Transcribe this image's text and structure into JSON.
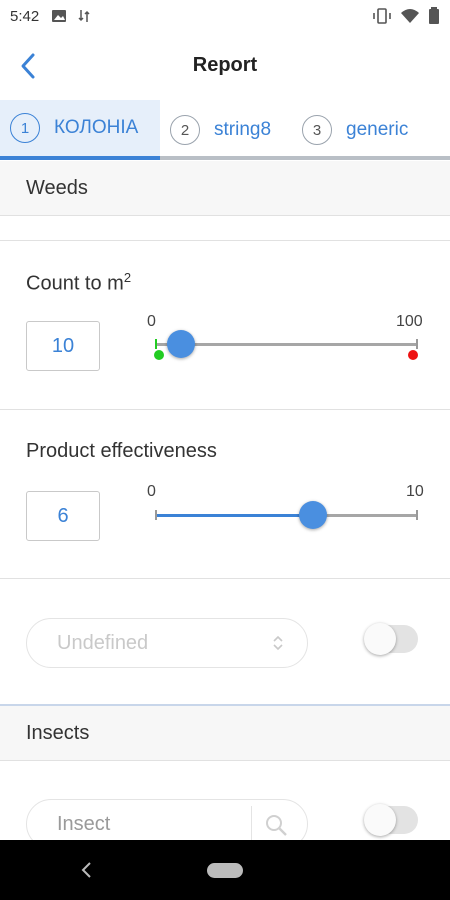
{
  "status_bar": {
    "time": "5:42"
  },
  "header": {
    "title": "Report"
  },
  "tabs": [
    {
      "number": "1",
      "label": "КОЛОНІА",
      "active": true
    },
    {
      "number": "2",
      "label": "string8",
      "active": false
    },
    {
      "number": "3",
      "label": "generic",
      "active": false
    }
  ],
  "weeds": {
    "section_title": "Weeds",
    "count": {
      "label": "Count to m",
      "superscript": "2",
      "value": "10",
      "min": "0",
      "max": "100",
      "slider_value": 10
    },
    "effectiveness": {
      "label": "Product effectiveness",
      "value": "6",
      "min": "0",
      "max": "10",
      "slider_value": 6
    },
    "select": {
      "value": "Undefined",
      "toggle_on": false
    }
  },
  "insects": {
    "section_title": "Insects",
    "search_placeholder": "Insect",
    "toggle_on": false
  },
  "colors": {
    "accent": "#3b82d6",
    "min_marker": "#22cc22",
    "max_marker": "#ee1111"
  }
}
